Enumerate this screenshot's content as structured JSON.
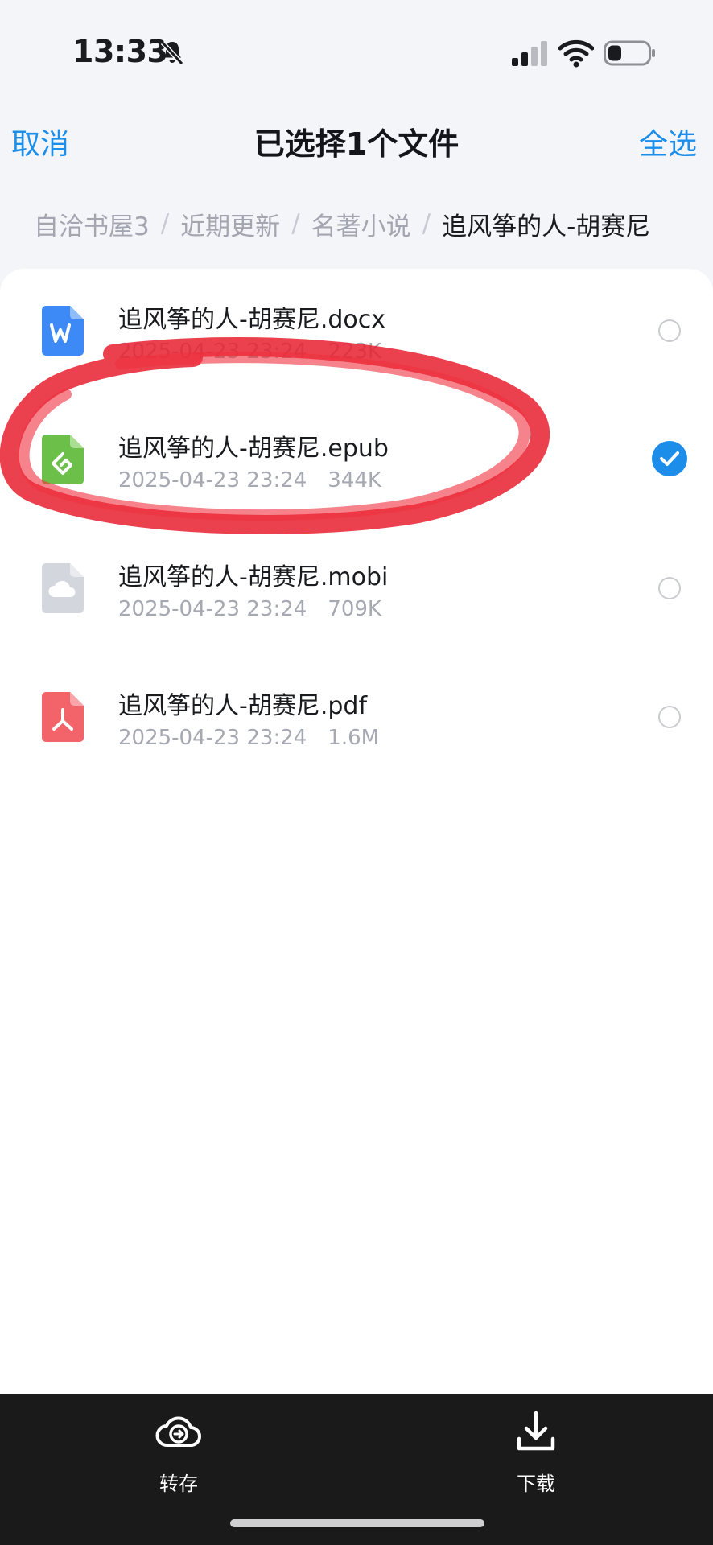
{
  "status_bar": {
    "time": "13:33",
    "icons": [
      "bell-slash-icon",
      "signal-icon",
      "wifi-icon",
      "battery-icon"
    ]
  },
  "header": {
    "cancel_label": "取消",
    "title": "已选择1个文件",
    "select_all_label": "全选"
  },
  "breadcrumb": {
    "items": [
      "自洽书屋3",
      "近期更新",
      "名著小说",
      "追风筝的人-胡赛尼"
    ],
    "separator": "/"
  },
  "files": [
    {
      "name": "追风筝的人-胡赛尼.docx",
      "date": "2025-04-23 23:24",
      "size": "223K",
      "icon": "word-doc-icon",
      "icon_color": "#3d8af7",
      "selected": false
    },
    {
      "name": "追风筝的人-胡赛尼.epub",
      "date": "2025-04-23 23:24",
      "size": "344K",
      "icon": "epub-icon",
      "icon_color": "#6cc04a",
      "selected": true
    },
    {
      "name": "追风筝的人-胡赛尼.mobi",
      "date": "2025-04-23 23:24",
      "size": "709K",
      "icon": "cloud-file-icon",
      "icon_color": "#cfd3da",
      "selected": false
    },
    {
      "name": "追风筝的人-胡赛尼.pdf",
      "date": "2025-04-23 23:24",
      "size": "1.6M",
      "icon": "pdf-icon",
      "icon_color": "#f2636a",
      "selected": false
    }
  ],
  "bottom_bar": {
    "save_label": "转存",
    "download_label": "下载"
  },
  "colors": {
    "accent": "#1c8ee9",
    "annotation": "#e8202f",
    "bottom_bar_bg": "#1a1a1b"
  }
}
